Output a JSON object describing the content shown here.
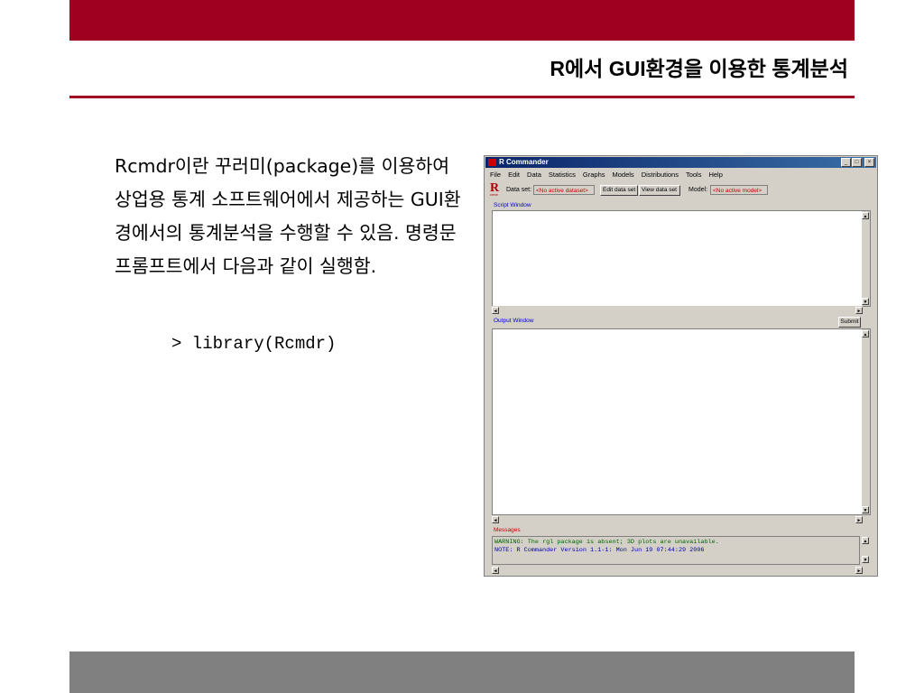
{
  "slide": {
    "title": "R에서 GUI환경을 이용한 통계분석",
    "body_text": "Rcmdr이란 꾸러미(package)를 이용하여 상업용 통계 소프트웨어에서 제공하는 GUI환경에서의 통계분석을 수행할 수 있음. 명령문 프롬프트에서 다음과 같이 실행함.",
    "code": "> library(Rcmdr)"
  },
  "rcommander": {
    "title": "R Commander",
    "window_buttons": [
      "_",
      "□",
      "×"
    ],
    "menu": [
      "File",
      "Edit",
      "Data",
      "Statistics",
      "Graphs",
      "Models",
      "Distributions",
      "Tools",
      "Help"
    ],
    "logo": {
      "letter": "R",
      "sub": "cmdr"
    },
    "dataset_label": "Data set:",
    "dataset_value": "<No active dataset>",
    "edit_button": "Edit data set",
    "view_button": "View data set",
    "model_label": "Model:",
    "model_value": "<No active model>",
    "script_label": "Script Window",
    "output_label": "Output Window",
    "submit_button": "Submit",
    "messages_label": "Messages",
    "messages": [
      "WARNING: The rgl package is absent; 3D plots are unavailable.",
      "NOTE: R Commander Version 1.1-1: Mon Jun 19 07:44:29 2006"
    ]
  },
  "colors": {
    "accent": "#a0001f",
    "footer": "#808080",
    "warning_text": "#006600",
    "note_text": "#0000aa"
  }
}
